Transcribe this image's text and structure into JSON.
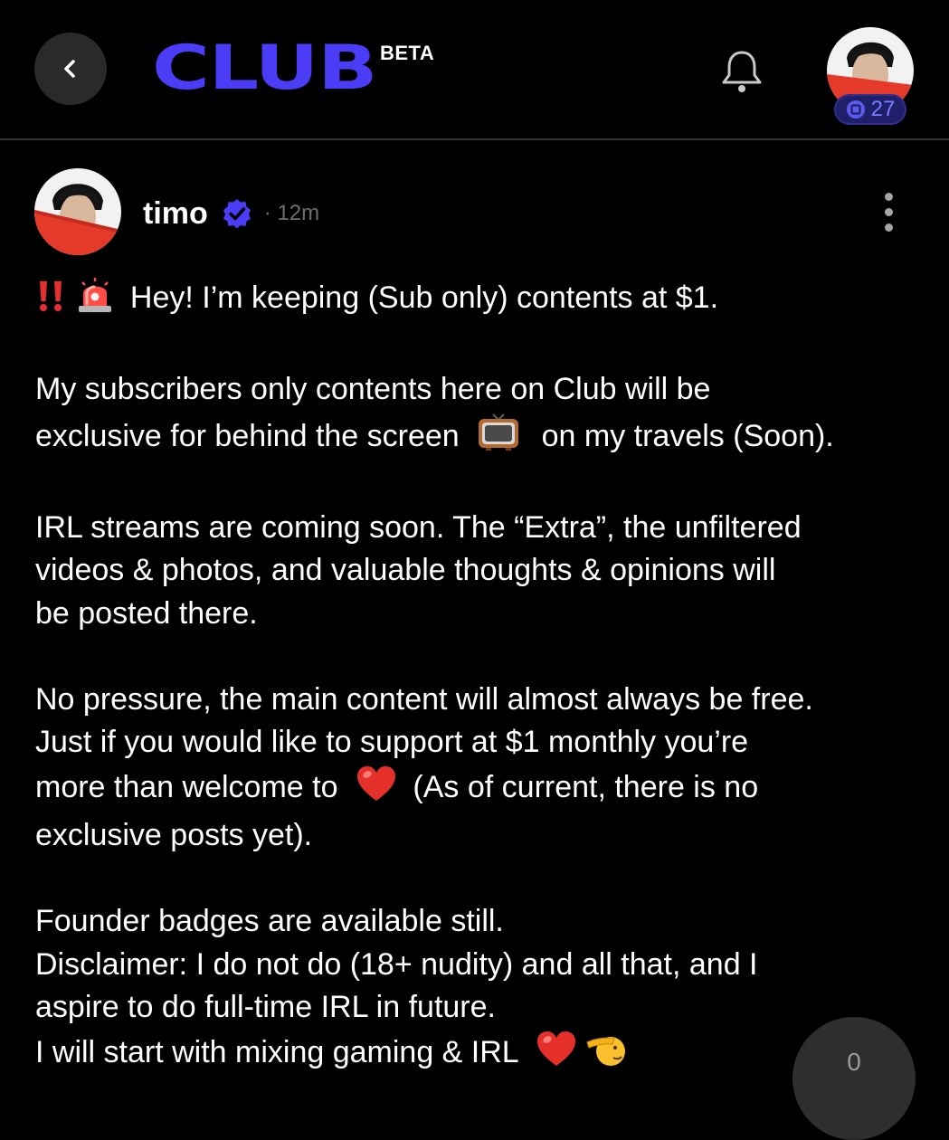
{
  "header": {
    "logo_text": "CLUB",
    "beta_label": "BETA",
    "coin_count": "27",
    "colors": {
      "brand": "#4b3cf5",
      "badge_bg": "#20206a",
      "badge_text": "#7b7bff"
    }
  },
  "post": {
    "author": "timo",
    "time": "· 12m",
    "verified_icon": "verified-badge-icon",
    "body": {
      "line1": "Hey! I’m keeping (Sub only) contents at $1.",
      "p2_line1": "My subscribers only contents here on Club will be",
      "p2_line2a": "exclusive for behind the screen",
      "p2_line2b": "on my travels (Soon).",
      "p3_line1": "IRL streams are coming soon. The “Extra”, the unfiltered",
      "p3_line2": "videos & photos, and valuable thoughts & opinions will",
      "p3_line3": "be posted there.",
      "p4_line1": "No pressure, the main content will almost always be free.",
      "p4_line2": "Just if you would like to support at $1 monthly you’re",
      "p4_line3a": "more than welcome to",
      "p4_line3b": "(As of current, there is no",
      "p4_line4": "exclusive posts yet).",
      "p5_line1": "Founder badges are available still.",
      "p5_line2": "Disclaimer: I do not do (18+ nudity) and all that, and I",
      "p5_line3": "aspire to do full-time IRL in future.",
      "p5_line4": "I will start with mixing gaming & IRL"
    }
  },
  "floating_counter": {
    "value": "0"
  },
  "icons": [
    "back-arrow-icon",
    "bell-icon",
    "coin-icon",
    "verified-badge-icon",
    "more-vertical-icon",
    "double-exclamation-icon",
    "siren-icon",
    "television-icon",
    "heart-icon",
    "saluting-face-icon"
  ]
}
